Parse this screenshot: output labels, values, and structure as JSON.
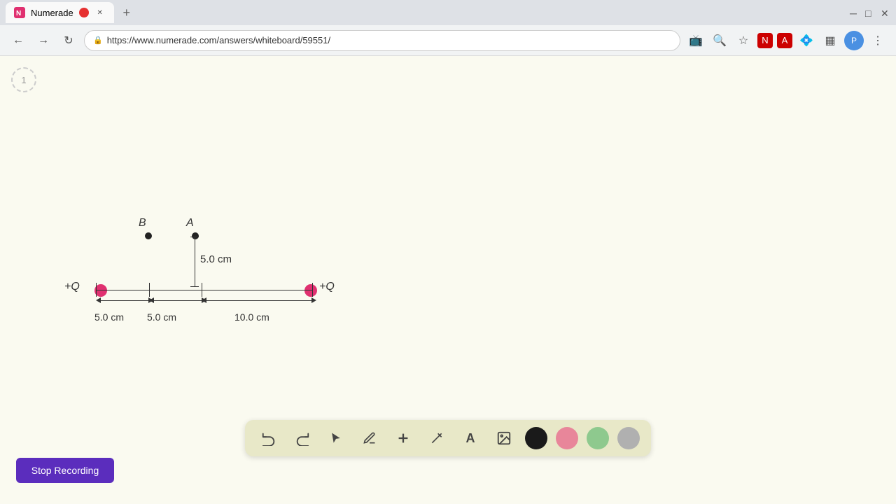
{
  "browser": {
    "tab_title": "Numerade",
    "url": "https://www.numerade.com/answers/whiteboard/59551/",
    "new_tab_label": "+"
  },
  "diagram": {
    "label_B": "B",
    "label_A": "A",
    "charge_left": "+Q",
    "charge_right": "+Q",
    "measurement_vert": "5.0 cm",
    "measurement_1": "5.0 cm",
    "measurement_2": "5.0 cm",
    "measurement_3": "10.0 cm"
  },
  "toolbar": {
    "undo_label": "↺",
    "redo_label": "↻",
    "select_label": "▲",
    "pen_label": "✏",
    "add_label": "+",
    "highlight_label": "/",
    "text_label": "A",
    "image_label": "🖼"
  },
  "colors": {
    "black": "#1a1a1a",
    "pink": "#e8869a",
    "green": "#8ec98e",
    "gray": "#b0b0b0"
  },
  "stop_recording": {
    "label": "Stop Recording"
  },
  "page_number": "1"
}
